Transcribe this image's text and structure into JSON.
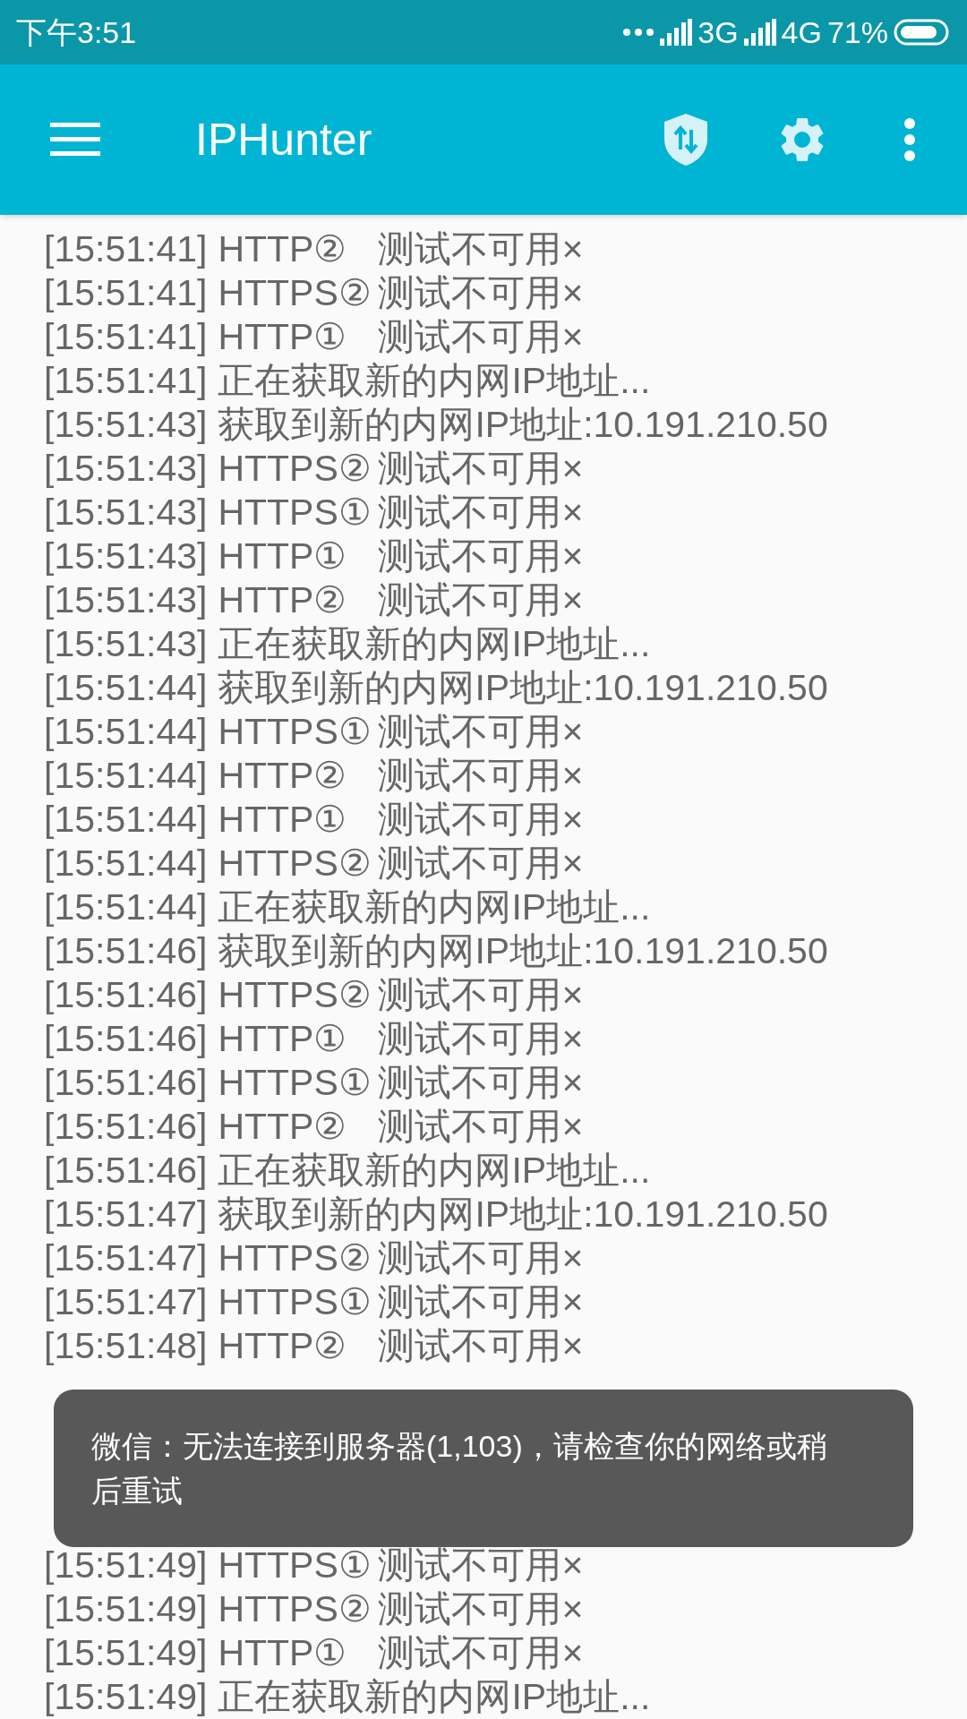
{
  "status_bar": {
    "time": "下午3:51",
    "network_1": "3G",
    "network_2": "4G",
    "battery": "71%"
  },
  "toolbar": {
    "title": "IPHunter"
  },
  "log": [
    {
      "time": "[15:51:41]",
      "text": "HTTP②",
      "result": "测试不可用×"
    },
    {
      "time": "[15:51:41]",
      "text": "HTTPS②",
      "result": "测试不可用×"
    },
    {
      "time": "[15:51:41]",
      "text": "HTTP①",
      "result": "测试不可用×"
    },
    {
      "time": "[15:51:41]",
      "text": "正在获取新的内网IP地址..."
    },
    {
      "time": "[15:51:43]",
      "text": "获取到新的内网IP地址:10.191.210.50"
    },
    {
      "time": "[15:51:43]",
      "text": "HTTPS②",
      "result": "测试不可用×"
    },
    {
      "time": "[15:51:43]",
      "text": "HTTPS①",
      "result": "测试不可用×"
    },
    {
      "time": "[15:51:43]",
      "text": "HTTP①",
      "result": "测试不可用×"
    },
    {
      "time": "[15:51:43]",
      "text": "HTTP②",
      "result": "测试不可用×"
    },
    {
      "time": "[15:51:43]",
      "text": "正在获取新的内网IP地址..."
    },
    {
      "time": "[15:51:44]",
      "text": "获取到新的内网IP地址:10.191.210.50"
    },
    {
      "time": "[15:51:44]",
      "text": "HTTPS①",
      "result": "测试不可用×"
    },
    {
      "time": "[15:51:44]",
      "text": "HTTP②",
      "result": "测试不可用×"
    },
    {
      "time": "[15:51:44]",
      "text": "HTTP①",
      "result": "测试不可用×"
    },
    {
      "time": "[15:51:44]",
      "text": "HTTPS②",
      "result": "测试不可用×"
    },
    {
      "time": "[15:51:44]",
      "text": "正在获取新的内网IP地址..."
    },
    {
      "time": "[15:51:46]",
      "text": "获取到新的内网IP地址:10.191.210.50"
    },
    {
      "time": "[15:51:46]",
      "text": "HTTPS②",
      "result": "测试不可用×"
    },
    {
      "time": "[15:51:46]",
      "text": "HTTP①",
      "result": "测试不可用×"
    },
    {
      "time": "[15:51:46]",
      "text": "HTTPS①",
      "result": "测试不可用×"
    },
    {
      "time": "[15:51:46]",
      "text": "HTTP②",
      "result": "测试不可用×"
    },
    {
      "time": "[15:51:46]",
      "text": "正在获取新的内网IP地址..."
    },
    {
      "time": "[15:51:47]",
      "text": "获取到新的内网IP地址:10.191.210.50"
    },
    {
      "time": "[15:51:47]",
      "text": "HTTPS②",
      "result": "测试不可用×"
    },
    {
      "time": "[15:51:47]",
      "text": "HTTPS①",
      "result": "测试不可用×"
    },
    {
      "time": "[15:51:48]",
      "text": "HTTP②",
      "result": "测试不可用×"
    }
  ],
  "toast": {
    "message": "微信：无法连接到服务器(1,103)，请检查你的网络或稍后重试"
  },
  "log_below_toast": [
    {
      "time": "[15:51:49]",
      "text": "HTTPS①",
      "result": "测试不可用×"
    },
    {
      "time": "[15:51:49]",
      "text": "HTTPS②",
      "result": "测试不可用×"
    },
    {
      "time": "[15:51:49]",
      "text": "HTTP①",
      "result": "测试不可用×"
    },
    {
      "time": "[15:51:49]",
      "text": "正在获取新的内网IP地址..."
    }
  ]
}
